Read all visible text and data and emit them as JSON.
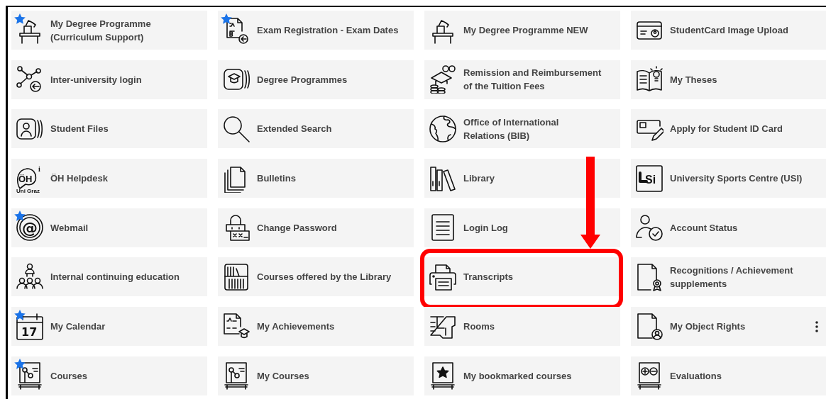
{
  "tiles": [
    {
      "label": "My Degree Programme\n(Curriculum Support)",
      "kind": "lectern",
      "favorite": true,
      "highlighted": false,
      "menu": false
    },
    {
      "label": "Exam Registration - Exam Dates",
      "kind": "exam-doc",
      "favorite": true,
      "highlighted": false,
      "menu": false
    },
    {
      "label": "My Degree Programme NEW",
      "kind": "lectern",
      "favorite": false,
      "highlighted": false,
      "menu": false
    },
    {
      "label": "StudentCard Image Upload",
      "kind": "id-card",
      "favorite": false,
      "highlighted": false,
      "menu": false
    },
    {
      "label": "Inter-university login",
      "kind": "network",
      "favorite": false,
      "highlighted": false,
      "menu": false
    },
    {
      "label": "Degree Programmes",
      "kind": "cap-card",
      "favorite": false,
      "highlighted": false,
      "menu": false
    },
    {
      "label": "Remission and Reimbursement\nof the Tuition Fees",
      "kind": "cap-coins",
      "favorite": false,
      "highlighted": false,
      "menu": false
    },
    {
      "label": "My Theses",
      "kind": "book-bulb",
      "favorite": false,
      "highlighted": false,
      "menu": false
    },
    {
      "label": "Student Files",
      "kind": "person-card",
      "favorite": false,
      "highlighted": false,
      "menu": false
    },
    {
      "label": "Extended Search",
      "kind": "search",
      "favorite": false,
      "highlighted": false,
      "menu": false
    },
    {
      "label": "Office of International\nRelations (BIB)",
      "kind": "globe",
      "favorite": false,
      "highlighted": false,
      "menu": false
    },
    {
      "label": "Apply for Student ID Card",
      "kind": "card-pen",
      "favorite": false,
      "highlighted": false,
      "menu": false
    },
    {
      "label": "ÖH Helpdesk",
      "kind": "oh-logo",
      "icon_text": [
        "ÖH",
        "i",
        "Uni Graz"
      ],
      "favorite": false,
      "highlighted": false,
      "menu": false
    },
    {
      "label": "Bulletins",
      "kind": "pages",
      "favorite": false,
      "highlighted": false,
      "menu": false
    },
    {
      "label": "Library",
      "kind": "books",
      "favorite": false,
      "highlighted": false,
      "menu": false
    },
    {
      "label": "University Sports Centre (USI)",
      "kind": "usi-logo",
      "icon_text": [
        "Si"
      ],
      "favorite": false,
      "highlighted": false,
      "menu": false
    },
    {
      "label": "Webmail",
      "kind": "at",
      "icon_text": [
        "@"
      ],
      "favorite": true,
      "highlighted": false,
      "menu": false
    },
    {
      "label": "Change Password",
      "kind": "padlock",
      "favorite": false,
      "highlighted": false,
      "menu": false
    },
    {
      "label": "Login Log",
      "kind": "doc-lines",
      "favorite": false,
      "highlighted": false,
      "menu": false
    },
    {
      "label": "Account Status",
      "kind": "person-check",
      "favorite": false,
      "highlighted": false,
      "menu": false
    },
    {
      "label": "Internal continuing education",
      "kind": "group",
      "favorite": false,
      "highlighted": false,
      "menu": false
    },
    {
      "label": "Courses offered by the Library",
      "kind": "bookshelf",
      "favorite": false,
      "highlighted": false,
      "menu": false
    },
    {
      "label": "Transcripts",
      "kind": "printer",
      "favorite": false,
      "highlighted": true,
      "menu": false
    },
    {
      "label": "Recognitions / Achievement\nsupplements",
      "kind": "cert-doc",
      "favorite": false,
      "highlighted": false,
      "menu": false
    },
    {
      "label": "My Calendar",
      "kind": "calendar",
      "icon_text": [
        "17"
      ],
      "favorite": true,
      "highlighted": false,
      "menu": false
    },
    {
      "label": "My Achievements",
      "kind": "ab-cap",
      "favorite": false,
      "highlighted": false,
      "menu": false
    },
    {
      "label": "Rooms",
      "kind": "floorplan",
      "favorite": false,
      "highlighted": false,
      "menu": false
    },
    {
      "label": "My Object Rights",
      "kind": "doc-person",
      "favorite": false,
      "highlighted": false,
      "menu": true
    },
    {
      "label": "Courses",
      "kind": "board-chart",
      "favorite": true,
      "highlighted": false,
      "menu": false
    },
    {
      "label": "My Courses",
      "kind": "board-chart",
      "favorite": false,
      "highlighted": false,
      "menu": false
    },
    {
      "label": "My bookmarked courses",
      "kind": "board-star",
      "favorite": false,
      "highlighted": false,
      "menu": false
    },
    {
      "label": "Evaluations",
      "kind": "board-plusminus",
      "favorite": false,
      "highlighted": false,
      "menu": false
    }
  ]
}
